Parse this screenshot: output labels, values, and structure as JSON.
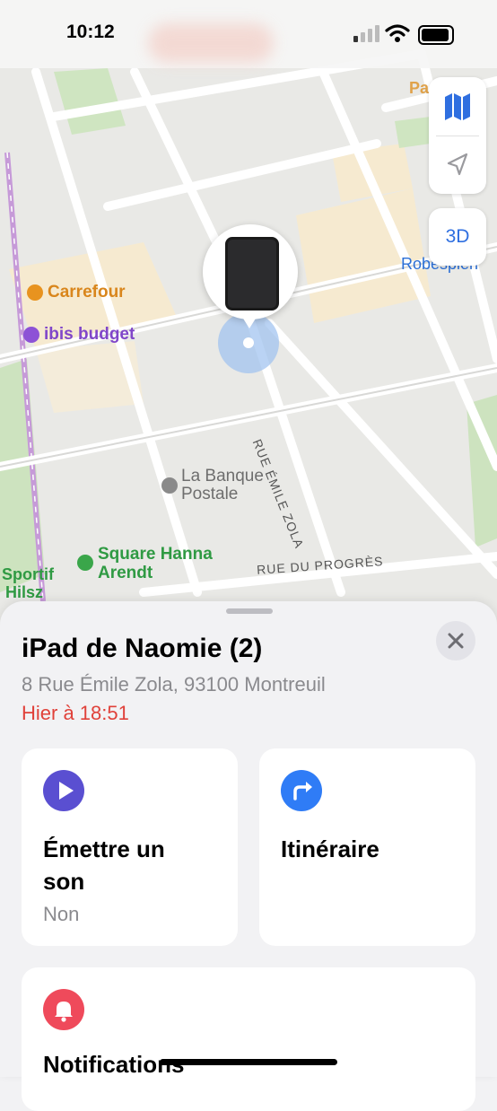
{
  "status_bar": {
    "time": "10:12"
  },
  "map": {
    "labels": {
      "carrefour": "Carrefour",
      "ibis": "ibis budget",
      "banque_line1": "La Banque",
      "banque_line2": "Postale",
      "square_line1": "Square Hanna",
      "square_line2": "Arendt",
      "rue_zola": "RUE ÉMILE ZOLA",
      "rue_progres": "RUE DU PROGRÈS",
      "robespierre": "Robespierr",
      "sportif_line1": "Sportif",
      "sportif_line2": "Hilsz",
      "top_right_partial": "Pa    oto"
    },
    "controls": {
      "view_3d": "3D"
    },
    "colors": {
      "poi_orange": "#e8931f",
      "poi_purple": "#8d52d6",
      "poi_green": "#3aa64a",
      "transit_blue": "#2b6fd6"
    }
  },
  "device": {
    "name": "iPad de Naomie (2)",
    "address": "8 Rue Émile Zola, 93100 Montreuil",
    "last_seen": "Hier à 18:51"
  },
  "actions": [
    {
      "title_line1": "Émettre un",
      "title_line2": "son",
      "subtitle": "Non",
      "icon": "play-icon",
      "color": "#5a4fd1"
    },
    {
      "title_line1": "Itinéraire",
      "icon": "directions-arrow-icon",
      "color": "#2f7cf6"
    },
    {
      "title_line1": "Notifications",
      "icon": "bell-icon",
      "color": "#ef4a5b"
    }
  ]
}
